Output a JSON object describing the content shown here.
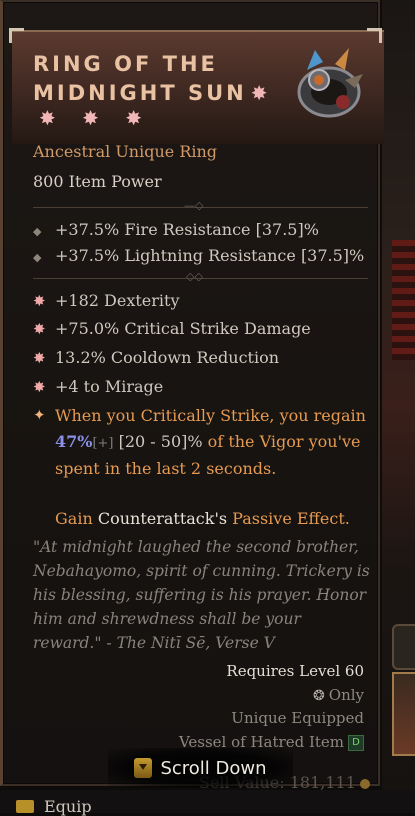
{
  "item": {
    "name_line1": "Ring of the",
    "name_line2": "Midnight Sun",
    "type": "Ancestral Unique Ring",
    "item_power": "800 Item Power",
    "suns": "✸ ✸ ✸"
  },
  "implicits": [
    "+37.5% Fire Resistance [37.5]%",
    "+37.5% Lightning Resistance [37.5]%"
  ],
  "affixes": [
    "+182 Dexterity",
    "+75.0% Critical Strike Damage",
    "13.2% Cooldown Reduction",
    "+4 to Mirage"
  ],
  "unique_power": {
    "intro": "When you Critically Strike, you regain",
    "pct": "47%",
    "plus": "[+]",
    "range": " [20 - 50]%",
    "rest": " of the Vigor you've spent in the last 2 seconds.",
    "gain": "Gain ",
    "skill": "Counterattack's",
    "passive": " Passive Effect."
  },
  "flavor": "\"At midnight laughed the second brother, Nebahayomo, spirit of cunning. Trickery is his blessing, suffering is his prayer. Honor him and shrewdness shall be your reward.\" - The Nitī Sē, Verse V",
  "requirements": {
    "level": "Requires Level 60",
    "class_only": "Only",
    "unique_equipped": "Unique Equipped",
    "vessel": "Vessel of Hatred Item",
    "vessel_badge": "D"
  },
  "sell_value": "Sell Value: 181,111",
  "scroll_button": "Scroll Down",
  "equip_label": "Equip",
  "colors": {
    "title": "#e9c2a3",
    "unique": "#d29a67",
    "legendary_text": "#e69a52",
    "percent": "#8a8fe8"
  },
  "icons": {
    "sun": "sun-icon",
    "diamond": "diamond-bullet-icon",
    "unique": "unique-power-icon",
    "class": "rogue-class-icon",
    "vessel": "vessel-of-hatred-icon",
    "scroll": "scroll-down-icon",
    "coin": "gold-coin-icon"
  }
}
